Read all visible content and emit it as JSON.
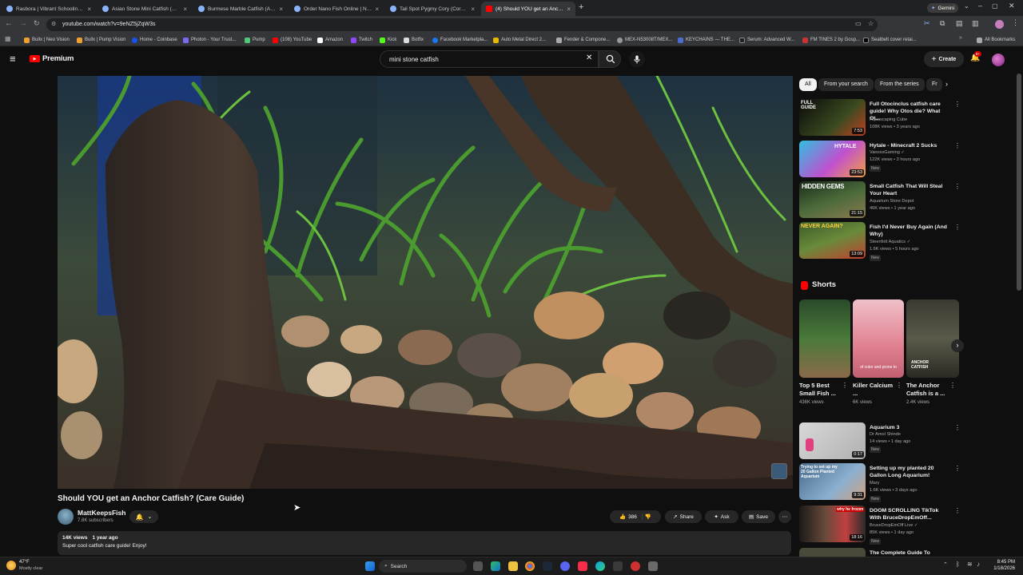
{
  "tabs": [
    {
      "label": "Rasbora | Vibrant Schooling Fish",
      "active": false
    },
    {
      "label": "Asian Stone Mini Catfish (Hara...",
      "active": false
    },
    {
      "label": "Burmese Marble Catfish (Akysis...",
      "active": false
    },
    {
      "label": "Order Nano Fish Online | Next...",
      "active": false
    },
    {
      "label": "Tail Spot Pygmy Cory (Corydoras...",
      "active": false
    },
    {
      "label": "(4) Should YOU get an Anch...",
      "active": true
    }
  ],
  "browser": {
    "url": "youtube.com/watch?v=9eNZ5jZqW3s",
    "gemini_label": "Gemini",
    "all_bookmarks": "All Bookmarks"
  },
  "bookmarks": [
    "Bullx | Neo Vision",
    "Bullx | Pump Vision",
    "Home - Coinbase",
    "Photon - Your Trust...",
    "Pump",
    "(108) YouTube",
    "Amazon",
    "Twitch",
    "Kick",
    "Botfix",
    "Facebook Marketpla...",
    "Auto Metal Direct 2...",
    "Fender & Compone...",
    "MEX-N53008T/MEX...",
    "KEYCHAINS — THE...",
    "Serum: Advanced W...",
    "FM TINES 2 by Gosp...",
    "Seatbelt cover retai..."
  ],
  "youtube": {
    "logo_text": "Premium",
    "search_value": "mini stone catfish",
    "create_label": "Create",
    "notification_count": "9+"
  },
  "video": {
    "title": "Should YOU get an Anchor Catfish? (Care Guide)",
    "channel": "MattKeepsFish",
    "subscribers": "7.8K subscribers",
    "likes": "386",
    "share_label": "Share",
    "ask_label": "Ask",
    "save_label": "Save",
    "views": "14K views",
    "age": "1 year ago",
    "description": "Super cool catfish care guide! Enjoy!"
  },
  "chips": [
    "All",
    "From your search",
    "From the series",
    "Fr"
  ],
  "recommendations": [
    {
      "title": "Full Otocinclus catfish care guide! Why Otos die? What Ot...",
      "channel": "Aquascaping Cube",
      "meta": "108K views • 3 years ago",
      "badge": "",
      "duration": "7:53",
      "thumb_text": "FULL GUIDE"
    },
    {
      "title": "Hytale - Minecraft 2 Sucks",
      "channel": "VanossGaming ✓",
      "meta": "122K views • 3 hours ago",
      "badge": "New",
      "duration": "23:53",
      "thumb_text": "HYTALE"
    },
    {
      "title": "Small Catfish That Will Steal Your Heart",
      "channel": "Aquarium Store Depot",
      "meta": "46K views • 1 year ago",
      "badge": "",
      "duration": "21:15",
      "thumb_text": "HIDDEN GEMS"
    },
    {
      "title": "Fish I'd Never Buy Again (And Why)",
      "channel": "Steenfott Aquatics ✓",
      "meta": "1.6K views • 5 hours ago",
      "badge": "New",
      "duration": "13:09",
      "thumb_text": "NEVER AGAIN?"
    }
  ],
  "shorts": {
    "heading": "Shorts",
    "items": [
      {
        "title": "Top 5 Best Small Fish ...",
        "views": "436K views"
      },
      {
        "title": "Killer Calcium ...",
        "views": "6K views",
        "caption": "of color and prone to"
      },
      {
        "title": "The Anchor Catfish is a ...",
        "views": "2.4K views",
        "caption": "ANCHOR CATFISH"
      }
    ]
  },
  "recommendations2": [
    {
      "title": "Aquarium 3",
      "channel": "Dr Amol Shinde",
      "meta": "14 views • 1 day ago",
      "badge": "New",
      "duration": "0:17"
    },
    {
      "title": "Setting up my planted 20 Gallon Long Aquarium!",
      "channel": "Mary",
      "meta": "1.6K views • 3 days ago",
      "badge": "New",
      "duration": "9:31",
      "thumb_text": "Trying to set up my 20 Gallon Planted Aquarium"
    },
    {
      "title": "DOOM SCROLLING TikTok With BruceDropEmOff...",
      "channel": "BruceDropEmOff Live ✓",
      "meta": "85K views • 1 day ago",
      "badge": "New",
      "duration": "18:16",
      "thumb_text": "why he frozen"
    },
    {
      "title": "The Complete Guide To",
      "channel": "",
      "meta": "",
      "badge": "",
      "duration": ""
    }
  ],
  "taskbar": {
    "temperature": "47°F",
    "weather": "Mostly clear",
    "search_label": "Search",
    "time": "8:45 PM",
    "date": "1/18/2026"
  },
  "colors": {
    "youtube_red": "#ff0000",
    "background": "#0f0f0f",
    "chip_bg": "#272727"
  }
}
